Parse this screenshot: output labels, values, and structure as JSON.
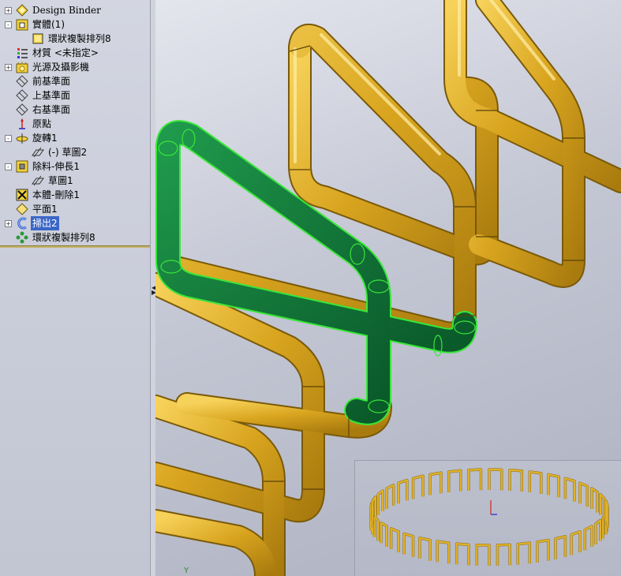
{
  "feature_tree": {
    "items": [
      {
        "label": "Design Binder",
        "icon": "design-binder-icon",
        "expander": "+"
      },
      {
        "label": "實體(1)",
        "icon": "solid-bodies-folder-icon",
        "expander": "-"
      },
      {
        "label": "環狀複製排列8",
        "icon": "solid-body-icon",
        "expander": ""
      },
      {
        "label": "材質 <未指定>",
        "icon": "material-icon",
        "expander": ""
      },
      {
        "label": "光源及攝影機",
        "icon": "lights-cameras-icon",
        "expander": "+"
      },
      {
        "label": "前基準面",
        "icon": "plane-icon",
        "expander": ""
      },
      {
        "label": "上基準面",
        "icon": "plane-icon",
        "expander": ""
      },
      {
        "label": "右基準面",
        "icon": "plane-icon",
        "expander": ""
      },
      {
        "label": "原點",
        "icon": "origin-icon",
        "expander": ""
      },
      {
        "label": "旋轉1",
        "icon": "revolve-icon",
        "expander": "-"
      },
      {
        "label": "(-) 草圖2",
        "icon": "sketch-icon",
        "expander": ""
      },
      {
        "label": "除料-伸長1",
        "icon": "extruded-cut-icon",
        "expander": "-"
      },
      {
        "label": "草圖1",
        "icon": "sketch-icon",
        "expander": ""
      },
      {
        "label": "本體-刪除1",
        "icon": "delete-body-icon",
        "expander": ""
      },
      {
        "label": "平面1",
        "icon": "plane-icon",
        "expander": ""
      },
      {
        "label": "掃出2",
        "icon": "sweep-icon",
        "expander": "+",
        "selected": true
      },
      {
        "label": "環狀複製排列8",
        "icon": "circular-pattern-icon",
        "expander": ""
      }
    ]
  },
  "viewport": {
    "pipe_color": "#e0b12a",
    "pipe_shadow": "#8a6a10",
    "highlight_color": "#0d7a3a",
    "highlight_edge": "#39e639",
    "axis_label": "Y"
  }
}
